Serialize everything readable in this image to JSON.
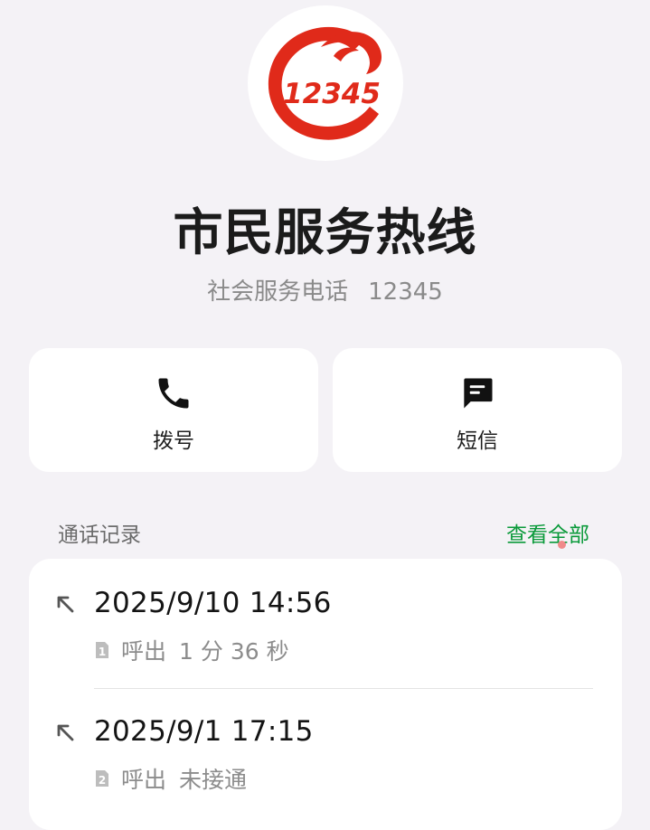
{
  "contact": {
    "logo_text": "12345",
    "name": "市民服务热线",
    "category": "社会服务电话",
    "number": "12345"
  },
  "actions": {
    "dial_label": "拨号",
    "sms_label": "短信"
  },
  "call_history": {
    "title": "通话记录",
    "view_all_label": "查看全部",
    "records": [
      {
        "datetime": "2025/9/10 14:56",
        "sim": "1",
        "direction": "呼出",
        "detail": "1 分 36 秒",
        "type_icon": "outgoing-call-arrow-icon"
      },
      {
        "datetime": "2025/9/1 17:15",
        "sim": "2",
        "direction": "呼出",
        "detail": "未接通",
        "type_icon": "outgoing-call-arrow-icon"
      }
    ]
  },
  "colors": {
    "background": "#f4f2f6",
    "card": "#ffffff",
    "accent_green": "#0a9a3a",
    "logo_red": "#e02a1a",
    "badge_dot": "#f08a8a"
  }
}
